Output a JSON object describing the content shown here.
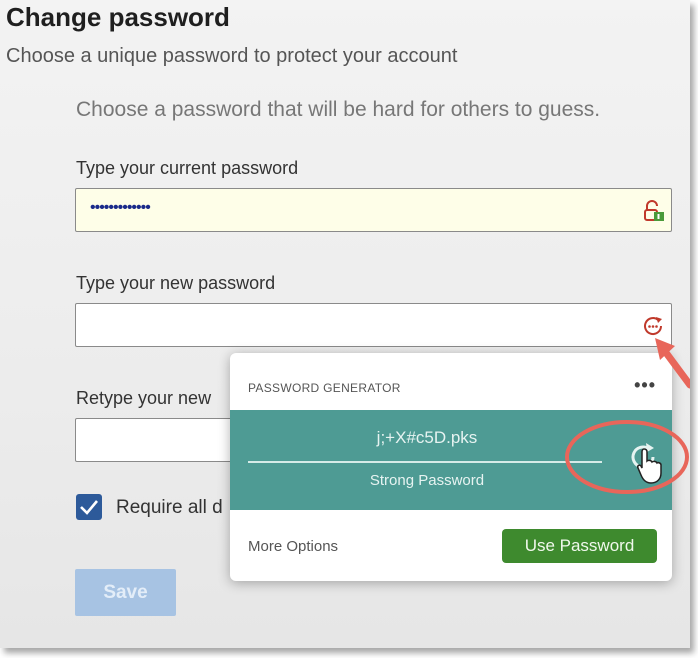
{
  "page": {
    "title": "Change password",
    "subtitle": "Choose a unique password to protect your account",
    "hint": "Choose a password that will be hard for others to guess."
  },
  "form": {
    "current_label": "Type your current password",
    "current_value": "•••••••••••••",
    "new_label": "Type your new password",
    "new_value": "",
    "retype_label": "Retype your new",
    "retype_value": "",
    "checkbox_label": "Require all d",
    "checkbox_checked": true,
    "save_label": "Save"
  },
  "generator": {
    "title": "PASSWORD GENERATOR",
    "menu": "•••",
    "generated_password": "j;+X#c5D.pks",
    "strength": "Strong Password",
    "more_options": "More Options",
    "use_password": "Use Password"
  },
  "colors": {
    "generator_bg": "#4e9b94",
    "use_password_bg": "#3e8a2e",
    "annotation": "#e8665a",
    "save_disabled": "#a7c3e3"
  },
  "icons": {
    "current_field": "password-manager-lock-icon",
    "new_field": "password-generator-icon",
    "refresh": "refresh-icon",
    "cursor": "hand-pointer-icon",
    "checkbox": "checkmark-icon"
  }
}
